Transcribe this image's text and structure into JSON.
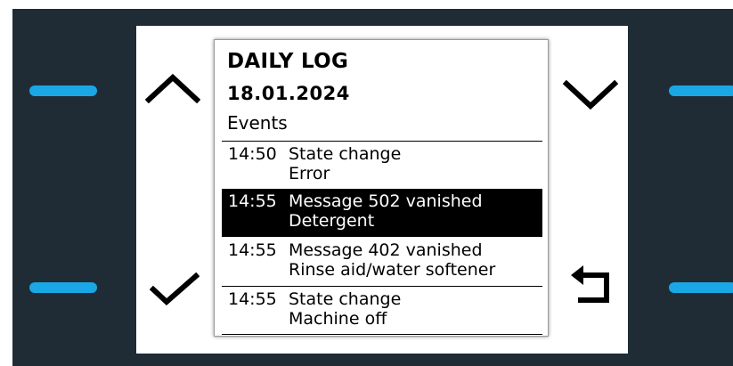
{
  "panel": {
    "title": "DAILY LOG",
    "date": "18.01.2024",
    "section": "Events"
  },
  "events": [
    {
      "time": "14:50",
      "line1": "State change",
      "line2": "Error",
      "selected": false
    },
    {
      "time": "14:55",
      "line1": "Message 502 vanished",
      "line2": "Detergent",
      "selected": true
    },
    {
      "time": "14:55",
      "line1": "Message 402 vanished",
      "line2": "Rinse aid/water softener",
      "selected": false
    },
    {
      "time": "14:55",
      "line1": "State change",
      "line2": "Machine off",
      "selected": false
    }
  ],
  "icons": {
    "up": "chevron-up-icon",
    "down": "chevron-down-icon",
    "confirm": "checkmark-icon",
    "back": "return-arrow-icon"
  },
  "colors": {
    "bezel": "#1f2c36",
    "hardware_key": "#1aa7e6",
    "selection": "#000000"
  }
}
